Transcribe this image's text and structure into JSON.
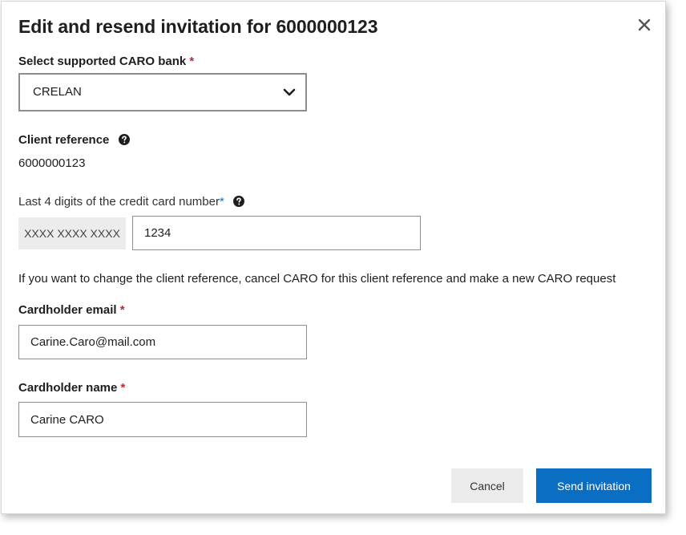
{
  "dialog": {
    "title": "Edit and resend invitation for 6000000123",
    "close_icon": "close-icon"
  },
  "bank": {
    "label": "Select supported CARO bank",
    "required_mark": "*",
    "selected": "CRELAN"
  },
  "client_reference": {
    "label": "Client reference",
    "value": "6000000123"
  },
  "credit_card": {
    "label": "Last 4 digits of the credit card number",
    "required_mark": "*",
    "prefix": "XXXX XXXX XXXX",
    "value": "1234"
  },
  "info_text": "If you want to change the client reference, cancel CARO for this client reference and make a new CARO request",
  "email": {
    "label": "Cardholder email",
    "required_mark": "*",
    "value": "Carine.Caro@mail.com"
  },
  "name": {
    "label": "Cardholder name",
    "required_mark": "*",
    "value": "Carine CARO"
  },
  "footer": {
    "cancel_label": "Cancel",
    "send_label": "Send invitation"
  },
  "colors": {
    "primary": "#0a6fc2",
    "required": "#c4262e"
  }
}
